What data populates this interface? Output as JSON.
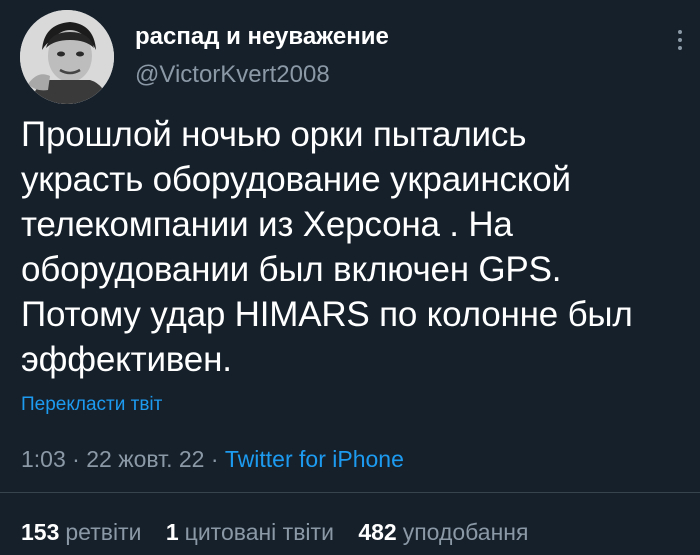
{
  "tweet": {
    "author": {
      "display_name": "распад и неуважение",
      "handle": "@VictorKvert2008",
      "avatar_icon": "avatar-photo"
    },
    "more_icon": "vertical-dots-icon",
    "lines": [
      "Прошлой ночью орки пытались",
      "украсть оборудование украинской",
      "телекомпании из Херсона . На",
      "оборудовании был включен GPS.",
      "Потому удар HIMARS по колонне был",
      "эффективен."
    ],
    "translate_label": "Перекласти твіт",
    "time": "1:03",
    "separator": "·",
    "date": "22 жовт. 22",
    "source": "Twitter for iPhone",
    "stats": {
      "retweets_count": "153",
      "retweets_label": "ретвіти",
      "quotes_count": "1",
      "quotes_label": "цитовані твіти",
      "likes_count": "482",
      "likes_label": "уподобання"
    }
  },
  "colors": {
    "background": "#15202b",
    "text": "#ffffff",
    "secondary": "#8b98a5",
    "link": "#1d9bf0",
    "divider": "#38444d"
  }
}
